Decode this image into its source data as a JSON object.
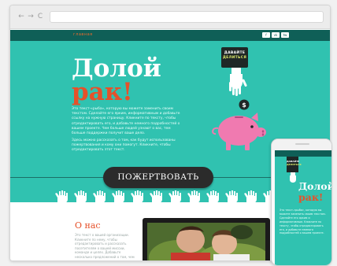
{
  "browser": {
    "nav_back": "←",
    "nav_forward": "→",
    "nav_reload": "C"
  },
  "site": {
    "logo_small": "главная",
    "social": [
      "f",
      "vk",
      "tw"
    ],
    "title_line1": "Долой",
    "title_line2": "рак!",
    "intro_paragraph": "Это текст-«рыба», которую вы можете заменить своим текстом. Сделайте его ярким, информативным и добавьте ссылку на нужную страницу. Кликните по тексту, чтобы отредактировать его, и добавьте немного подробностей о вашем проекте. Чем больше людей узнают о вас, тем больше поддержки получит ваше дело.",
    "intro_paragraph2": "Здесь можно рассказать о том, как будут использованы пожертвования и кому они помогут. Кликните, чтобы отредактировать этот текст.",
    "give_sign_line1": "ДАВАЙТЕ",
    "give_sign_line2": "ДЕЛИТЬСЯ",
    "donate_button": "ПОЖЕРТВОВАТЬ",
    "about_title": "О нас",
    "about_text": "Это текст о вашей организации. Кликните по нему, чтобы отредактировать и рассказать посетителям о вашей миссии, команде и целях. Добавьте несколько предложений о том, чем вы занимаетесь.",
    "accent_color": "#30c2b0",
    "dark_strip_color": "#0f5f57",
    "title_accent_color": "#e6512a",
    "piggy_color": "#f07ab0",
    "icons": [
      "arrow-left-icon",
      "arrow-right-icon",
      "reload-icon",
      "hand-icon",
      "coin-icon",
      "piggy-bank-icon"
    ]
  },
  "phone": {
    "give_sign_line1": "ДАВАЙТЕ",
    "give_sign_line2": "ДЕЛИТЬСЯ",
    "title_line1": "Долой",
    "title_line2": "рак!",
    "text": "Это текст-«рыба», которую вы можете заменить своим текстом. Сделайте его ярким и информативным. Кликните по тексту, чтобы отредактировать его, и добавьте немного подробностей о вашем проекте."
  }
}
